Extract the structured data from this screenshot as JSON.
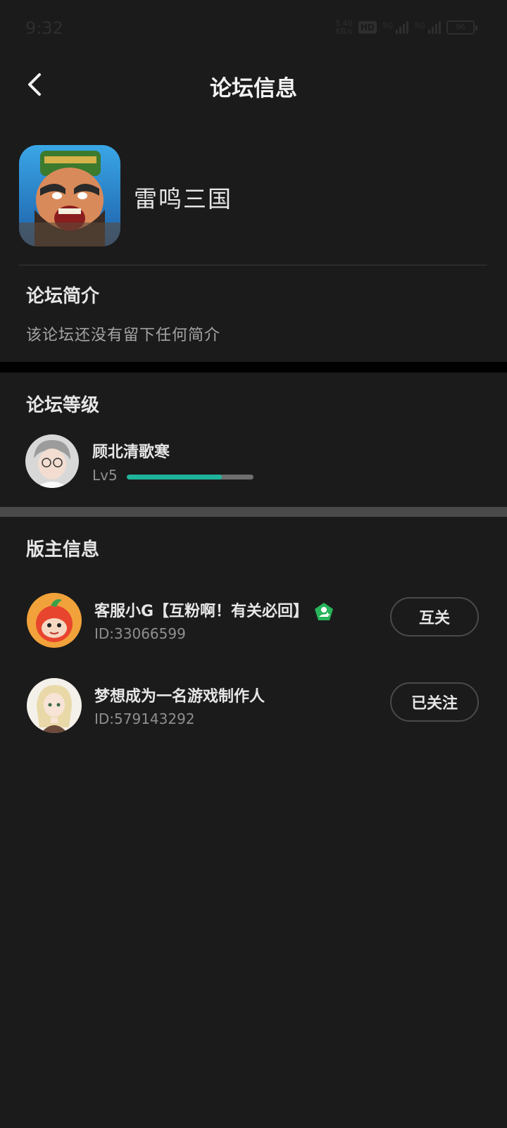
{
  "status_bar": {
    "time": "9:32",
    "net_speed_value": "5.40",
    "net_speed_unit": "KB/s",
    "hd": "HD",
    "sim1": "5G",
    "sim2": "5G",
    "battery": "96"
  },
  "header": {
    "title": "论坛信息",
    "back_icon": "chevron-left-icon"
  },
  "forum": {
    "name": "雷鸣三国",
    "intro_title": "论坛简介",
    "intro_text": "该论坛还没有留下任何简介"
  },
  "level_section": {
    "title": "论坛等级",
    "user_name": "顾北清歌寒",
    "level": "Lv5",
    "progress": 0.75,
    "progress_color": "#1fb39b"
  },
  "moderator_section": {
    "title": "版主信息",
    "moderators": [
      {
        "name": "客服小G【互粉啊！有关必回】",
        "id": "ID:33066599",
        "button": "互关",
        "has_badge": true
      },
      {
        "name": "梦想成为一名游戏制作人",
        "id": "ID:579143292",
        "button": "已关注",
        "has_badge": false
      }
    ]
  },
  "colors": {
    "background": "#1b1b1b",
    "accent": "#1fb39b",
    "badge": "#27b35a"
  }
}
